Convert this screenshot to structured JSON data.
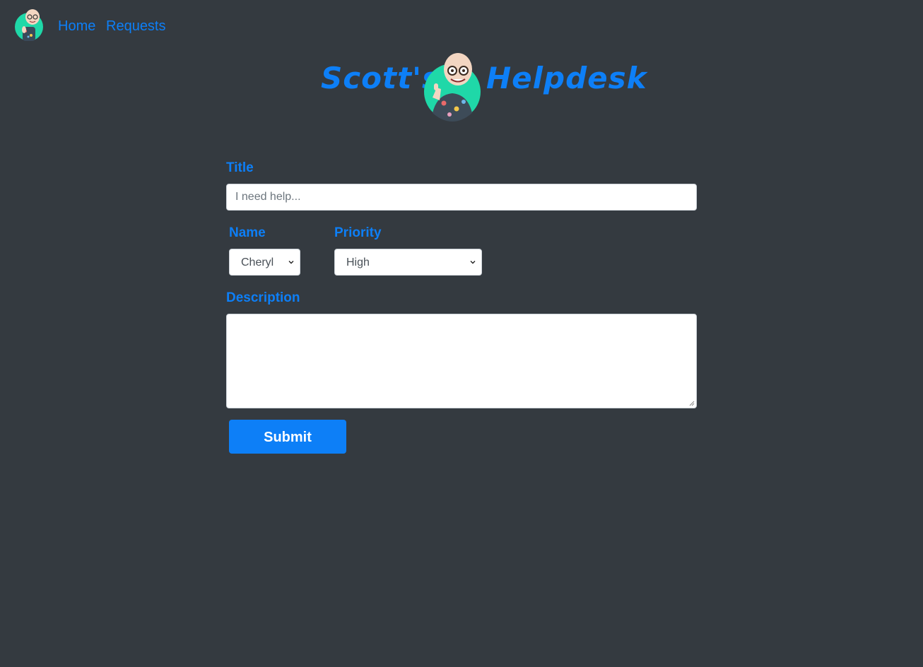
{
  "nav": {
    "avatar_icon": "cartoon-avatar-icon",
    "links": [
      {
        "label": "Home"
      },
      {
        "label": "Requests"
      }
    ],
    "link_color": "#0d7ff7"
  },
  "brand": {
    "left_text": "Scott's",
    "right_text": "Helpdesk",
    "avatar_icon": "cartoon-avatar-icon",
    "color": "#0d7ff7"
  },
  "form": {
    "title_label": "Title",
    "title_placeholder": "I need help...",
    "title_value": "",
    "name_label": "Name",
    "name_selected": "Cheryl",
    "priority_label": "Priority",
    "priority_selected": "High",
    "description_label": "Description",
    "description_value": "",
    "submit_label": "Submit"
  },
  "colors": {
    "background": "#343a40",
    "accent": "#0d7ff7",
    "button_text": "#ffffff"
  }
}
